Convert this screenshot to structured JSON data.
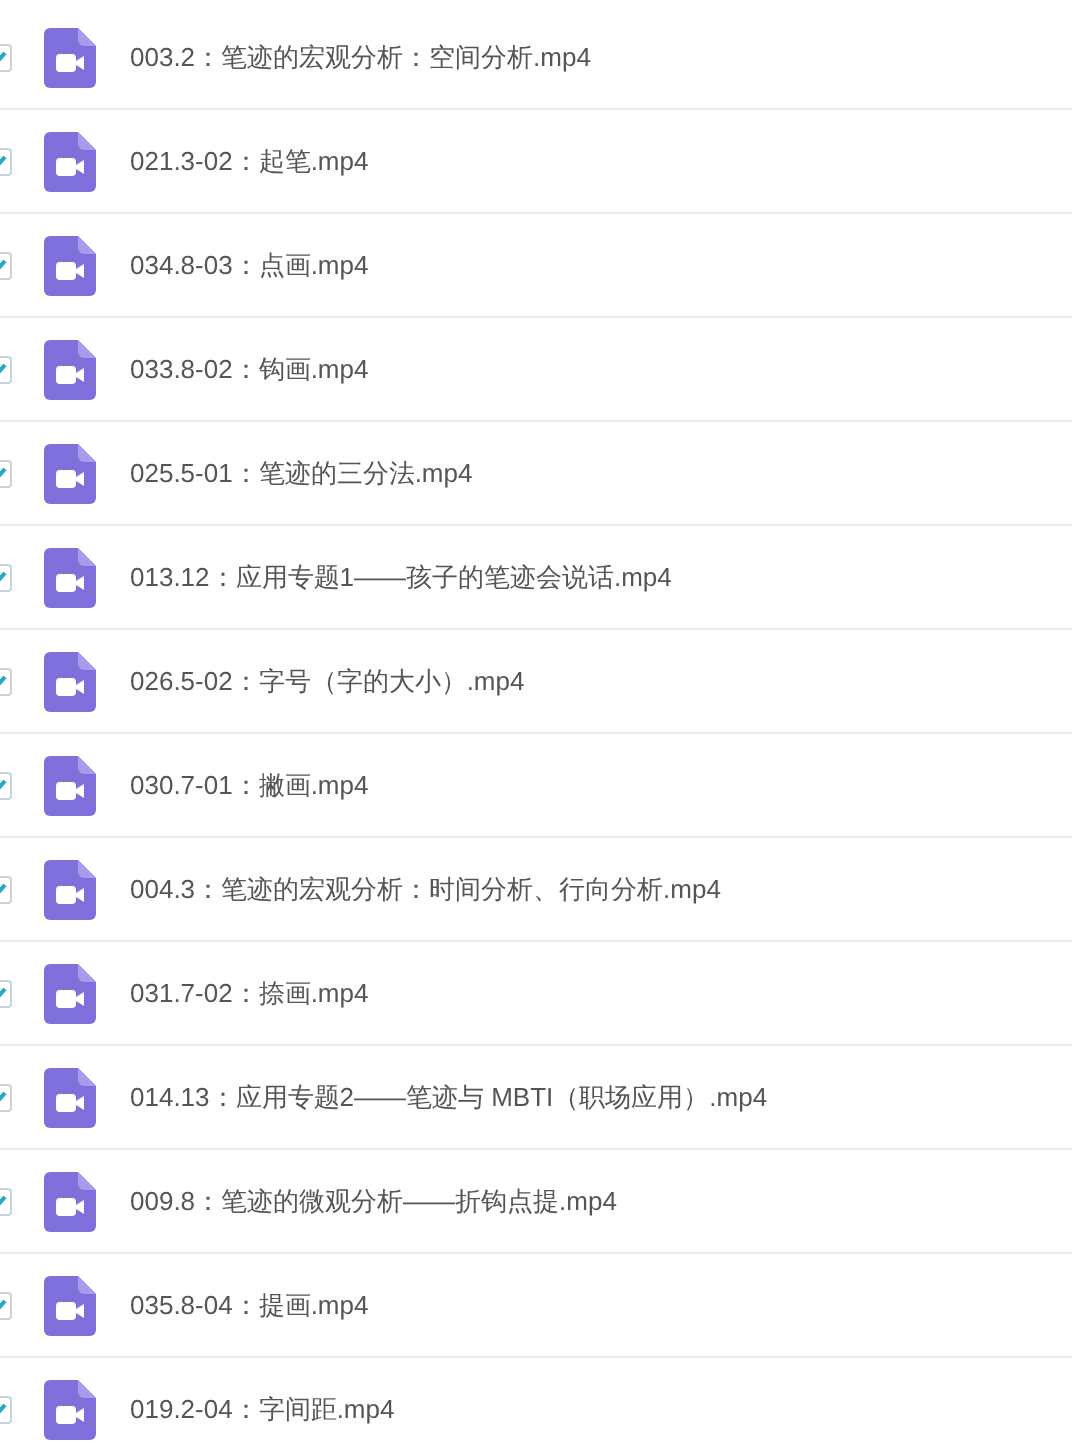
{
  "files": [
    {
      "name": "003.2：笔迹的宏观分析：空间分析.mp4",
      "checked": true
    },
    {
      "name": "021.3-02：起笔.mp4",
      "checked": true
    },
    {
      "name": "034.8-03：点画.mp4",
      "checked": true
    },
    {
      "name": "033.8-02：钩画.mp4",
      "checked": true
    },
    {
      "name": "025.5-01：笔迹的三分法.mp4",
      "checked": true
    },
    {
      "name": "013.12：应用专题1——孩子的笔迹会说话.mp4",
      "checked": true
    },
    {
      "name": "026.5-02：字号（字的大小）.mp4",
      "checked": true
    },
    {
      "name": "030.7-01：撇画.mp4",
      "checked": true
    },
    {
      "name": "004.3：笔迹的宏观分析：时间分析、行向分析.mp4",
      "checked": true
    },
    {
      "name": "031.7-02：捺画.mp4",
      "checked": true
    },
    {
      "name": "014.13：应用专题2——笔迹与 MBTI（职场应用）.mp4",
      "checked": true
    },
    {
      "name": "009.8：笔迹的微观分析——折钩点提.mp4",
      "checked": true
    },
    {
      "name": "035.8-04：提画.mp4",
      "checked": true
    },
    {
      "name": "019.2-04：字间距.mp4",
      "checked": true
    }
  ]
}
